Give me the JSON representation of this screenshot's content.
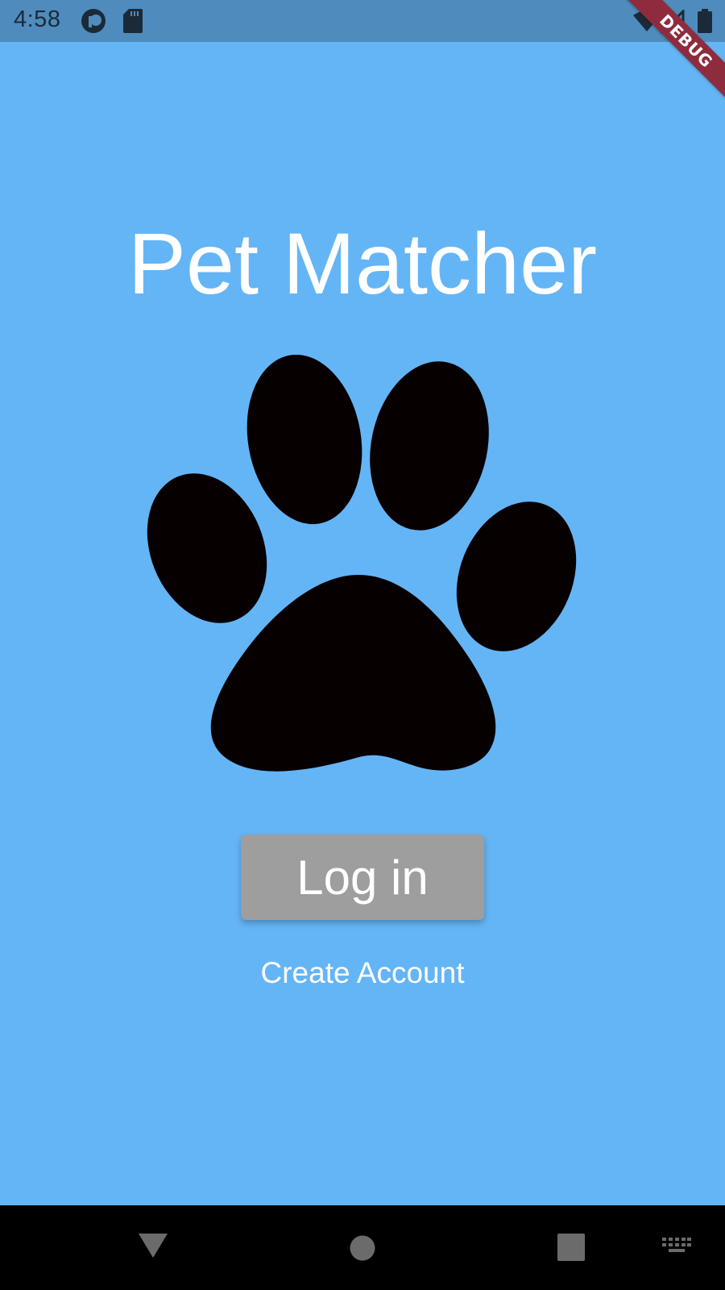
{
  "status_bar": {
    "time": "4:58"
  },
  "debug_banner": {
    "label": "DEBUG",
    "color": "#8e2c3e"
  },
  "app": {
    "title": "Pet Matcher",
    "logo_icon": "paw-print-icon",
    "background_color": "#64b5f6"
  },
  "actions": {
    "login_label": "Log in",
    "create_account_label": "Create Account"
  },
  "nav_bar": {
    "icons": [
      "back-icon",
      "home-icon",
      "recents-icon",
      "keyboard-icon"
    ]
  }
}
